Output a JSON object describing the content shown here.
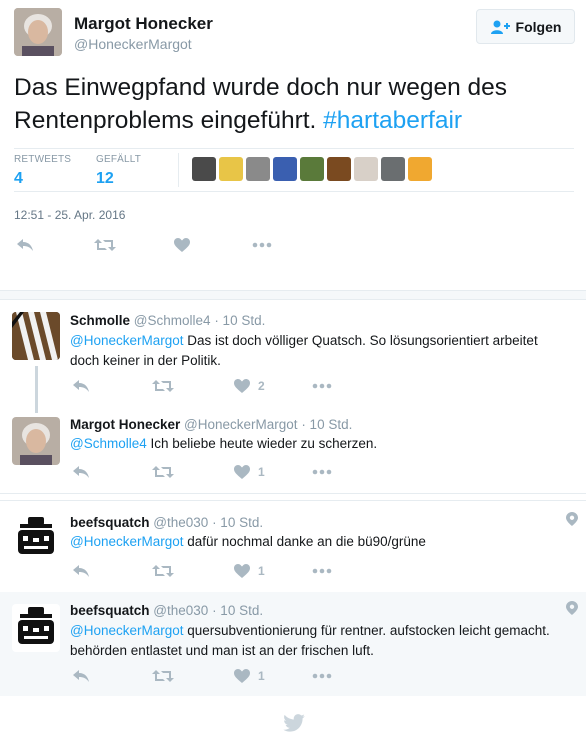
{
  "main_tweet": {
    "name": "Margot Honecker",
    "handle": "@HoneckerMargot",
    "follow_label": "Folgen",
    "text": "Das Einwegpfand wurde doch nur wegen des Rentenproblems eingeführt.",
    "hashtag": "#hartaberfair",
    "retweets_label": "RETWEETS",
    "retweets_count": "4",
    "likes_label": "GEFÄLLT",
    "likes_count": "12",
    "timestamp": "12:51 - 25. Apr. 2016",
    "liker_colors": [
      "#4a4a4a",
      "#e8c547",
      "#8a8a8a",
      "#3a5fb0",
      "#5a7a3a",
      "#7a4a20",
      "#d8d0c8",
      "#6a6e70",
      "#f0a830"
    ]
  },
  "replies": [
    {
      "name": "Schmolle",
      "handle": "@Schmolle4",
      "time": "· 10 Std.",
      "mention": "@HoneckerMargot",
      "text": "Das ist doch völliger Quatsch. So lösungsorientiert arbeitet doch keiner in der Politik.",
      "likes": "2"
    },
    {
      "name": "Margot Honecker",
      "handle": "@HoneckerMargot",
      "time": "· 10 Std.",
      "mention": "@Schmolle4",
      "text": "Ich beliebe heute wieder zu scherzen.",
      "likes": "1"
    },
    {
      "name": "beefsquatch",
      "handle": "@the030",
      "time": "· 10 Std.",
      "mention": "@HoneckerMargot",
      "text": "dafür nochmal danke an die bü90/grüne",
      "likes": "1"
    },
    {
      "name": "beefsquatch",
      "handle": "@the030",
      "time": "· 10 Std.",
      "mention": "@HoneckerMargot",
      "text": "quersubventionierung für rentner. aufstocken leicht gemacht. behörden entlastet und man ist an der frischen luft.",
      "likes": "1"
    }
  ],
  "colors": {
    "link": "#1da1f2",
    "muted": "#8899a6",
    "icon": "#aab8c2"
  }
}
